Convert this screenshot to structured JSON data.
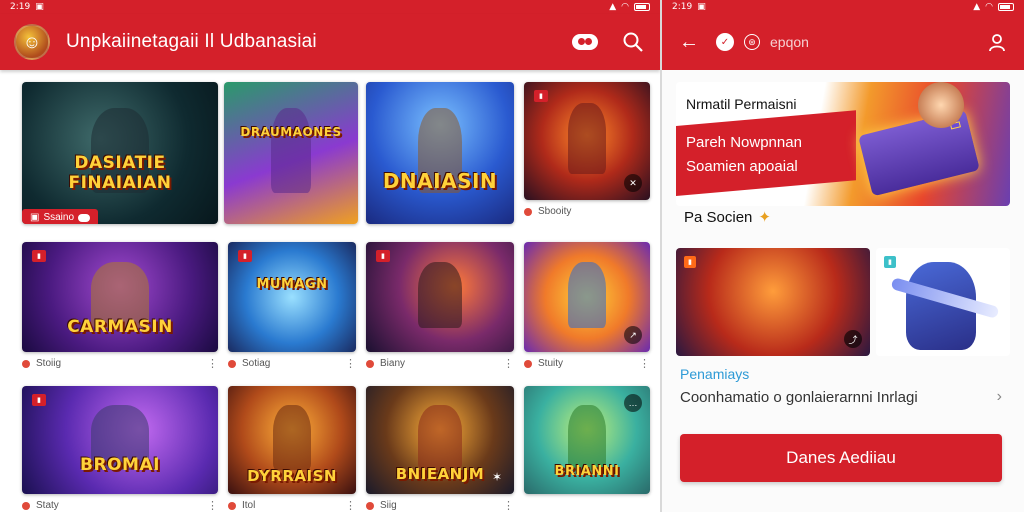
{
  "colors": {
    "accent": "#d4202a",
    "link": "#2d9ad6"
  },
  "left": {
    "status": {
      "time": "2:19",
      "icons_left": [
        "app-icon",
        "wifi-icon",
        "lock-icon"
      ],
      "icons_right": [
        "signal-icon",
        "wifi-icon",
        "battery-icon"
      ]
    },
    "appbar": {
      "title": "Unpkaiinetagaii Il Udbanasiai",
      "icons": [
        "gamepad-icon",
        "search-icon"
      ]
    },
    "games": [
      {
        "title": "DASIATIE FINAIAIAN",
        "badge": "",
        "chip": "Ssaino",
        "meta": ""
      },
      {
        "title": "DRAUMAONES",
        "badge": "",
        "chip": "",
        "meta": ""
      },
      {
        "title": "DNAIASIN",
        "badge": "",
        "chip": "",
        "meta": ""
      },
      {
        "title": "",
        "badge": "",
        "chip": "",
        "meta": "Sbooity"
      },
      {
        "title": "CARMASIN",
        "badge": "",
        "chip": "",
        "meta": "Stoiig"
      },
      {
        "title": "MUMAGN",
        "badge": "",
        "chip": "",
        "meta": "Sotiag"
      },
      {
        "title": "",
        "badge": "",
        "chip": "",
        "meta": "Biany"
      },
      {
        "title": "",
        "badge": "",
        "chip": "",
        "meta": "Stuity"
      },
      {
        "title": "BROMAI",
        "badge": "",
        "chip": "",
        "meta": "Staty"
      },
      {
        "title": "DYRRAISN",
        "badge": "",
        "chip": "",
        "meta": "Itol"
      },
      {
        "title": "BNIEANJM",
        "badge": "",
        "chip": "",
        "meta": "Siig"
      },
      {
        "title": "BRIANNI",
        "badge": "",
        "chip": "",
        "meta": ""
      }
    ]
  },
  "right": {
    "status": {
      "time": "2:19",
      "icons_left": [
        "app-icon",
        "lock-icon"
      ]
    },
    "appbar": {
      "back": "←",
      "search_text": "epqon"
    },
    "banner": {
      "title": "Nrmatil Permaisni",
      "line1": "Pareh Nowpnnan",
      "line2": "Soamien apoaial",
      "chest_label": ""
    },
    "subhead": "Pa Socien",
    "section_title": "Penamiays",
    "row_text": "Coonhamatio o gonlaierarnni Inrlagi",
    "cta": "Danes Aediiau"
  }
}
